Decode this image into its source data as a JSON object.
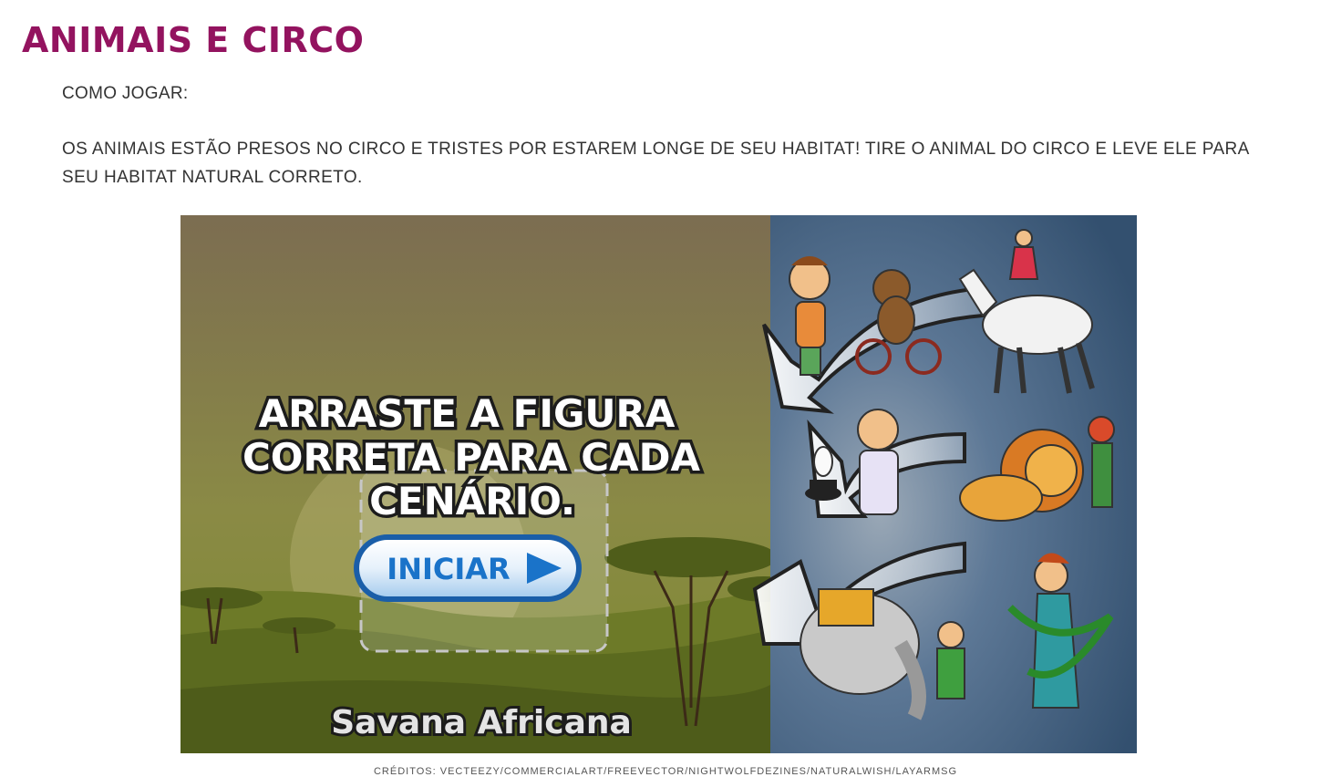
{
  "page": {
    "title": "ANIMAIS E CIRCO",
    "instructions_heading": "COMO JOGAR:",
    "instructions_text": "OS ANIMAIS ESTÃO PRESOS NO CIRCO E TRISTES POR ESTAREM LONGE DE SEU HABITAT! TIRE O ANIMAL DO CIRCO E LEVE ELE PARA SEU HABITAT NATURAL CORRETO.",
    "credits": "CRÉDITOS: VECTEEZY/COMMERCIALART/FREEVECTOR/NIGHTWOLFDEZINES/NATURALWISH/LAYARMSG"
  },
  "game": {
    "instruction_line1": "ARRASTE A FIGURA",
    "instruction_line2": "CORRETA PARA CADA",
    "instruction_line3": "CENÁRIO.",
    "start_button": "INICIAR",
    "habitat_label": "Savana Africana",
    "colors": {
      "sky_top": "#7d6f4f",
      "sky_bottom": "#8b9040",
      "ground": "#5b6a1f",
      "circus_bg": "#3d5a79",
      "title": "#93135f",
      "button_text": "#1a73c9"
    }
  }
}
